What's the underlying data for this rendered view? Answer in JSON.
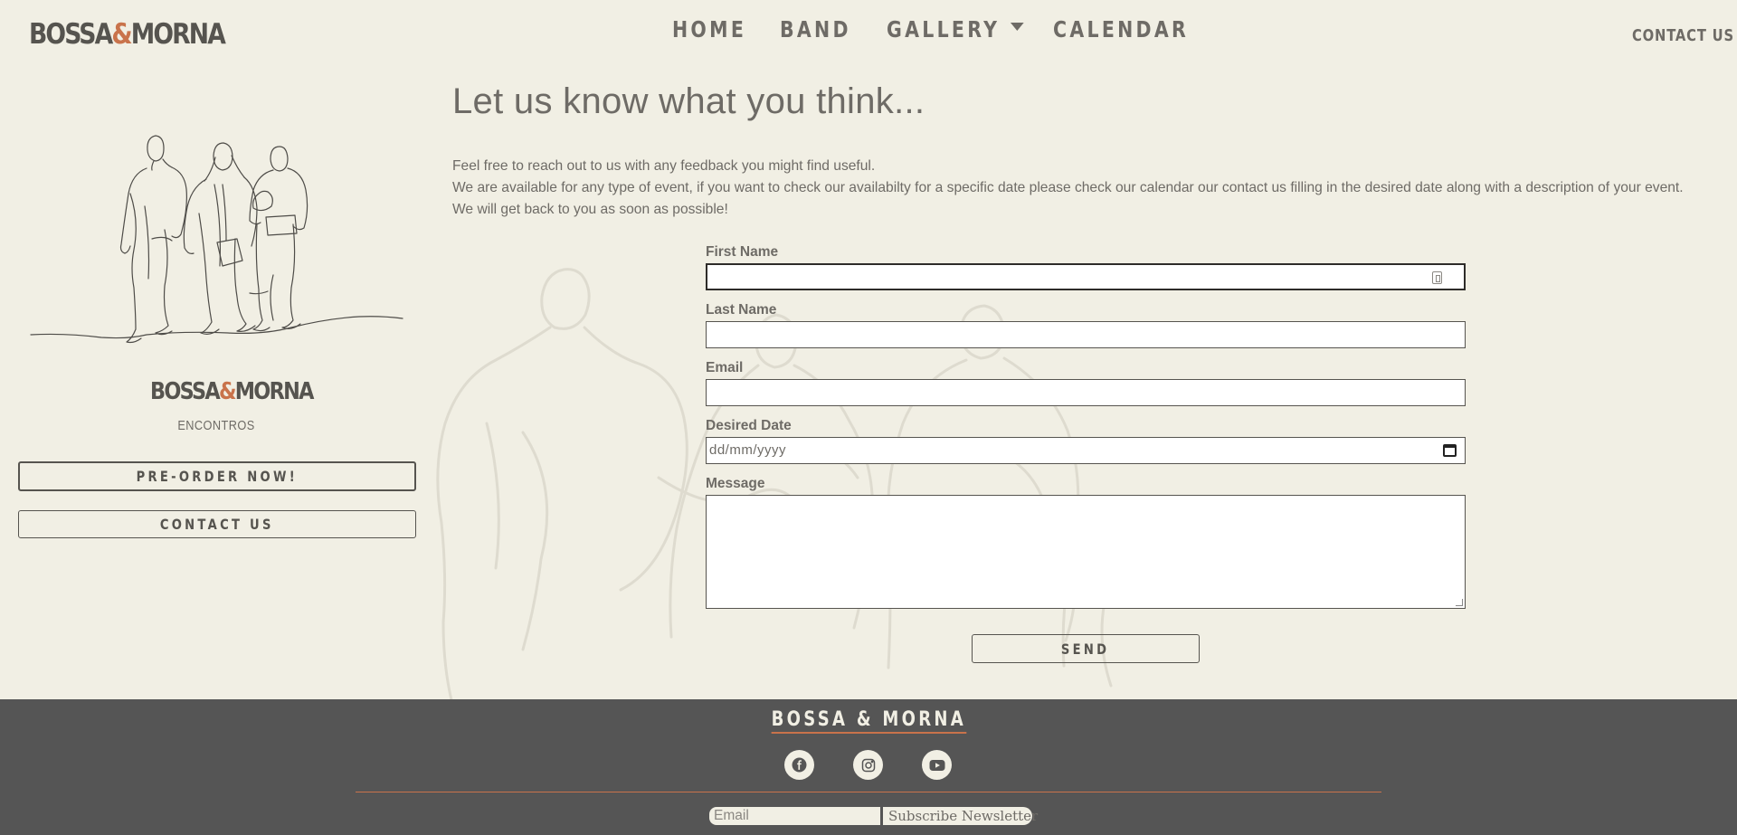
{
  "header": {
    "logo_left": "BOSSA",
    "logo_amp": "&",
    "logo_right": "MORNA",
    "nav": {
      "home": "HOME",
      "band": "BAND",
      "gallery": "GALLERY",
      "calendar": "CALENDAR"
    },
    "contact": "CONTACT US"
  },
  "sidebar": {
    "logo_left": "BOSSA",
    "logo_amp": "&",
    "logo_right": "MORNA",
    "subtitle": "ENCONTROS",
    "preorder_label": "PRE-ORDER NOW!",
    "contact_label": "CONTACT US"
  },
  "main": {
    "title": "Let us know what you think...",
    "intro": [
      "Feel free to reach out to us with any feedback you might find useful.",
      "We are available for any type of event, if you want to check our availabilty for a specific date please check our calendar our contact us filling in the desired date along with a description of your event.",
      "We will get back to you as soon as possible!"
    ],
    "form": {
      "first_name_label": "First Name",
      "last_name_label": "Last Name",
      "email_label": "Email",
      "date_label": "Desired Date",
      "date_placeholder": "dd/mm/yyyy",
      "message_label": "Message",
      "send_label": "SEND"
    }
  },
  "footer": {
    "logo": "BOSSA & MORNA",
    "social": [
      "facebook-icon",
      "instagram-icon",
      "youtube-icon"
    ],
    "newsletter_placeholder": "Email",
    "newsletter_button": "Subscribe Newsletter"
  },
  "colors": {
    "background": "#f1efe4",
    "text": "#6e6b66",
    "accent": "#c9734b",
    "footer": "#555555"
  }
}
